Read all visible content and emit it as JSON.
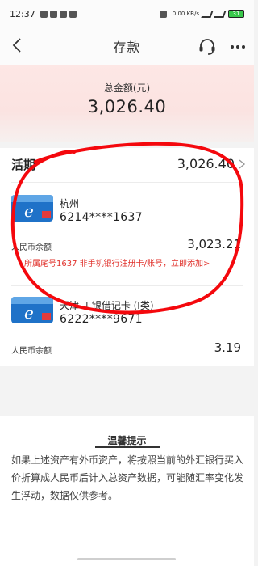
{
  "status": {
    "time": "12:37",
    "net_speed": "0.00 KB/s",
    "battery": "31"
  },
  "nav": {
    "title": "存款"
  },
  "total": {
    "label": "总金额(元)",
    "amount": "3,026.40"
  },
  "demand": {
    "label": "活期",
    "value": "3,026.40"
  },
  "accounts": [
    {
      "city": "杭州",
      "number": "6214****1637",
      "balance_label": "人民币余额",
      "balance": "3,023.21",
      "link_text": "所属尾号1637 非手机银行注册卡/账号，立即添加>"
    },
    {
      "city": "天津 工银借记卡 (I类)",
      "number": "6222****9671",
      "balance_label": "人民币余额",
      "balance": "3.19"
    }
  ],
  "tips": {
    "title": "温馨提示",
    "text": "如果上述资产有外币资产，将按照当前的外汇银行买入价折算成人民币后计入总资产数据，可能随汇率变化发生浮动，数据仅供参考。"
  },
  "colors": {
    "accent_red": "#e0302a",
    "annotation_red": "#f4080d",
    "card_blue": "#1f72c8"
  }
}
